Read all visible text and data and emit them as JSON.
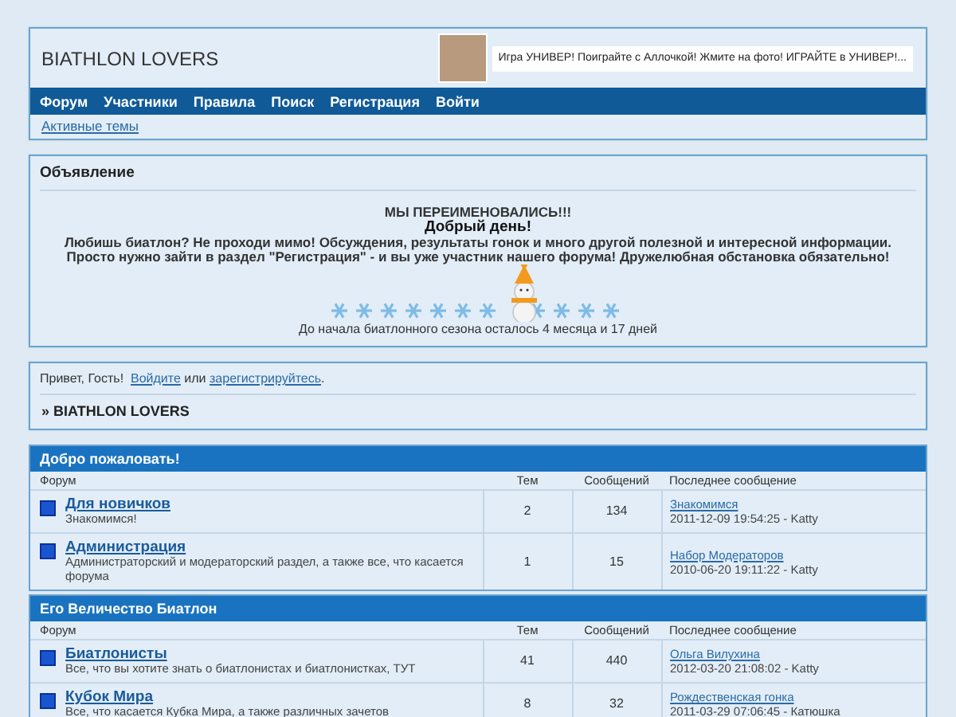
{
  "header": {
    "title": "BIATHLON LOVERS",
    "ad_text": "Игра УНИВЕР! Поиграйте с Аллочкой! Жмите на фото! ИГРАЙТЕ в УНИВЕР!..."
  },
  "nav": [
    "Форум",
    "Участники",
    "Правила",
    "Поиск",
    "Регистрация",
    "Войти"
  ],
  "sublinks": [
    "Активные темы"
  ],
  "announcement": {
    "title": "Объявление",
    "headline": "МЫ ПЕРЕИМЕНОВАЛИСЬ!!!",
    "greeting": "Добрый день!",
    "body": "Любишь биатлон? Не проходи мимо! Обсуждения, результаты гонок и много другой полезной и интересной информации. Просто нужно зайти в раздел \"Регистрация\" - и вы уже участник нашего форума! Дружелюбная обстановка обязательно!",
    "countdown": "До начала биатлонного сезона осталось  4 месяца и 17 дней"
  },
  "guest": {
    "greeting": "Привет, Гость!",
    "login": "Войдите",
    "or": "или",
    "register": "зарегистрируйтесь",
    "end": "."
  },
  "breadcrumb": "» BIATHLON LOVERS",
  "categories": [
    {
      "title": "Добро пожаловать!",
      "columns": [
        "Форум",
        "Тем",
        "Сообщений",
        "Последнее сообщение"
      ],
      "forums": [
        {
          "name": "Для новичков",
          "description": "Знакомимся!",
          "topics": "2",
          "posts": "134",
          "last_title": "Знакомимся",
          "last_meta": "2011-12-09 19:54:25 - Katty"
        },
        {
          "name": "Администрация",
          "description": "Администраторский и модераторский раздел, а также все, что касается форума",
          "topics": "1",
          "posts": "15",
          "last_title": "Набор Модераторов",
          "last_meta": "2010-06-20 19:11:22 - Katty"
        }
      ]
    },
    {
      "title": "Его Величество Биатлон",
      "columns": [
        "Форум",
        "Тем",
        "Сообщений",
        "Последнее сообщение"
      ],
      "forums": [
        {
          "name": "Биатлонисты",
          "description": "Все, что вы хотите знать о биатлонистах и биатлонистках, ТУТ",
          "topics": "41",
          "posts": "440",
          "last_title": "Ольга Вилухина",
          "last_meta": "2012-03-20 21:08:02 - Katty"
        },
        {
          "name": "Кубок Мира",
          "description": "Все, что касается Кубка Мира, а также различных зачетов",
          "topics": "8",
          "posts": "32",
          "last_title": "Рождественская гонка",
          "last_meta": "2011-03-29 07:06:45 - Катюшка"
        }
      ]
    }
  ]
}
